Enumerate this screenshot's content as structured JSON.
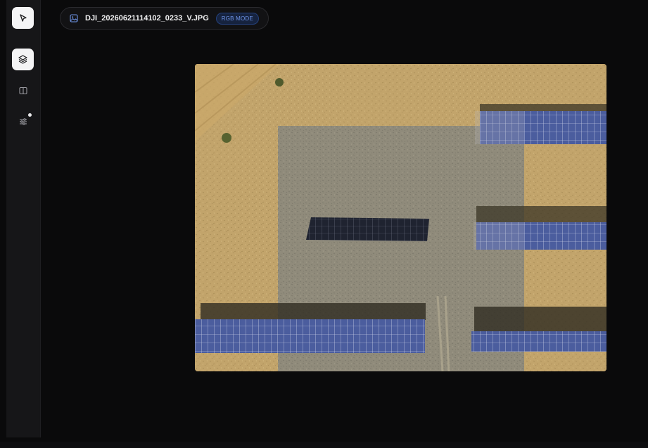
{
  "sidebar": {
    "tools": [
      {
        "icon": "cursor-icon",
        "active": true
      },
      {
        "icon": "layers-icon",
        "active": true
      },
      {
        "icon": "split-view-icon",
        "active": false
      },
      {
        "icon": "sliders-icon",
        "active": false,
        "indicator": true
      }
    ]
  },
  "file": {
    "icon": "image-icon",
    "name": "DJI_20260621114102_0233_V.JPG",
    "mode": "RGB MODE"
  },
  "colors": {
    "accent": "#6f95e8",
    "active_tool_bg": "#f4f4f5",
    "background": "#0a0a0b",
    "sidebar": "#161618"
  }
}
